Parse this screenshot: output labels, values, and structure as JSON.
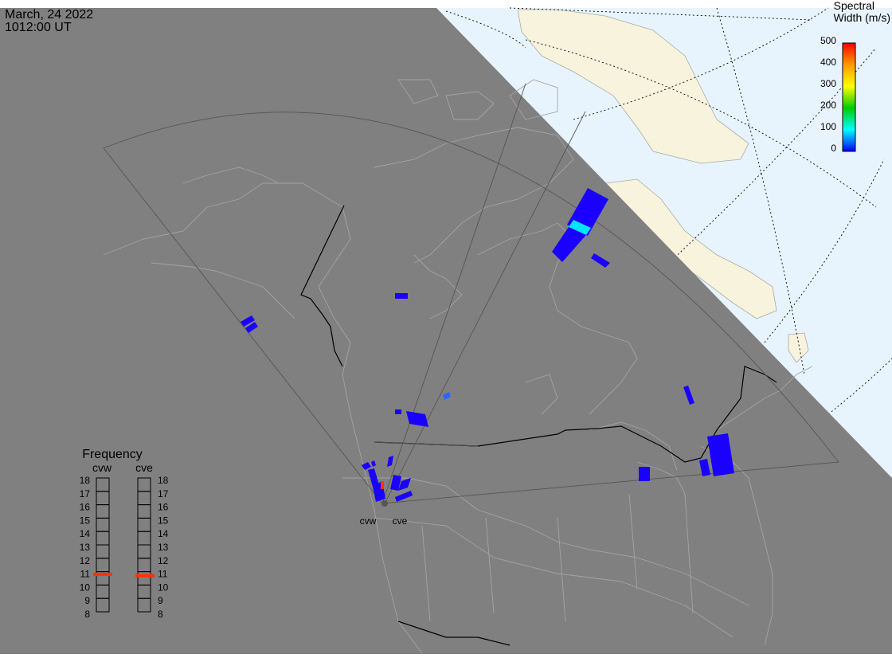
{
  "header": {
    "date": "March, 24 2022",
    "time": "1012:00 UT"
  },
  "colorbar": {
    "title_line1": "Spectral",
    "title_line2": "Width (m/s)",
    "ticks": [
      "500",
      "400",
      "300",
      "200",
      "100",
      "0"
    ],
    "gradient": [
      "#ff0000",
      "#ff9900",
      "#ffff00",
      "#00cc00",
      "#00ffff",
      "#0000ff"
    ]
  },
  "radars": [
    {
      "code": "cvw"
    },
    {
      "code": "cve"
    }
  ],
  "frequency": {
    "title": "Frequency",
    "col_left": "cvw",
    "col_right": "cve",
    "levels": [
      "18",
      "17",
      "16",
      "15",
      "14",
      "13",
      "12",
      "11",
      "10",
      "9",
      "8"
    ],
    "cvw_value": 10.8,
    "cve_value": 10.7
  },
  "colors": {
    "ocean": "#e8f4fd",
    "land": "#f7f3dc",
    "night": "#808080",
    "coast_night": "#a3a3a3",
    "echo_blue": "#2200ff",
    "echo_cyan": "#00e5ff",
    "marker": "#ff3300"
  }
}
